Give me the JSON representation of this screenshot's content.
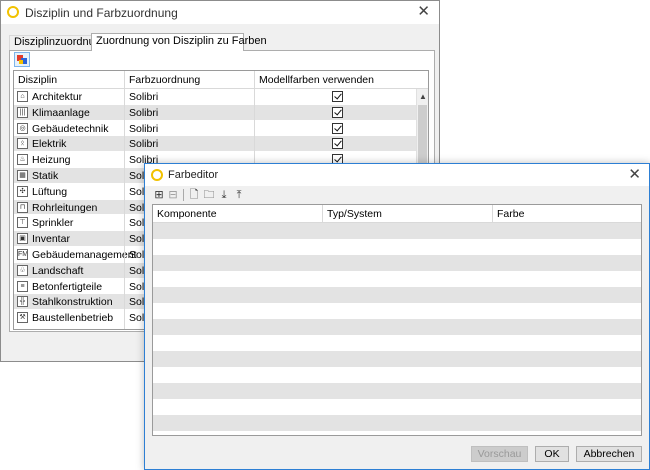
{
  "main_window": {
    "title": "Disziplin und Farbzuordnung",
    "tabs": [
      {
        "label": "Disziplinzuordnung"
      },
      {
        "label": "Zuordnung von Disziplin zu Farben"
      }
    ],
    "columns": [
      "Disziplin",
      "Farbzuordnung",
      "Modellfarben verwenden"
    ],
    "rows": [
      {
        "icon": "architecture-icon",
        "glyph": "⌂",
        "name": "Architektur",
        "color_assignment": "Solibri",
        "use_model_colors": true
      },
      {
        "icon": "hvac-icon",
        "glyph": "|||",
        "name": "Klimaanlage",
        "color_assignment": "Solibri",
        "use_model_colors": true
      },
      {
        "icon": "building-services-icon",
        "glyph": "◎",
        "name": "Gebäudetechnik",
        "color_assignment": "Solibri",
        "use_model_colors": true
      },
      {
        "icon": "electrical-icon",
        "glyph": "ᛟ",
        "name": "Elektrik",
        "color_assignment": "Solibri",
        "use_model_colors": true
      },
      {
        "icon": "heating-icon",
        "glyph": "♨",
        "name": "Heizung",
        "color_assignment": "Solibri",
        "use_model_colors": true
      },
      {
        "icon": "structural-icon",
        "glyph": "▦",
        "name": "Statik",
        "color_assignment": "Solibri",
        "use_model_colors": true
      },
      {
        "icon": "ventilation-icon",
        "glyph": "✣",
        "name": "Lüftung",
        "color_assignment": "Solibri",
        "use_model_colors": true
      },
      {
        "icon": "plumbing-icon",
        "glyph": "⊓",
        "name": "Rohrleitungen",
        "color_assignment": "Solibri",
        "use_model_colors": true
      },
      {
        "icon": "sprinkler-icon",
        "glyph": "⊤",
        "name": "Sprinkler",
        "color_assignment": "Solibri",
        "use_model_colors": true
      },
      {
        "icon": "furniture-icon",
        "glyph": "▣",
        "name": "Inventar",
        "color_assignment": "Solibri",
        "use_model_colors": true
      },
      {
        "icon": "facility-management-icon",
        "glyph": "FM",
        "name": "Gebäudemanagement",
        "color_assignment": "Solibri",
        "use_model_colors": true
      },
      {
        "icon": "landscape-icon",
        "glyph": "♧",
        "name": "Landschaft",
        "color_assignment": "Solibri",
        "use_model_colors": true
      },
      {
        "icon": "precast-icon",
        "glyph": "≡",
        "name": "Betonfertigteile",
        "color_assignment": "Solibri",
        "use_model_colors": true
      },
      {
        "icon": "steel-structure-icon",
        "glyph": "╬",
        "name": "Stahlkonstruktion",
        "color_assignment": "Solibri",
        "use_model_colors": true
      },
      {
        "icon": "site-operations-icon",
        "glyph": "⚒",
        "name": "Baustellenbetrieb",
        "color_assignment": "Solibri",
        "use_model_colors": true
      }
    ]
  },
  "color_editor": {
    "title": "Farbeditor",
    "toolbar": [
      "add-row-icon",
      "remove-row-icon",
      "new-file-icon",
      "open-folder-icon",
      "import-icon",
      "export-icon"
    ],
    "columns": [
      "Komponente",
      "Typ/System",
      "Farbe"
    ],
    "buttons": {
      "preview": "Vorschau",
      "ok": "OK",
      "cancel": "Abbrechen"
    }
  }
}
